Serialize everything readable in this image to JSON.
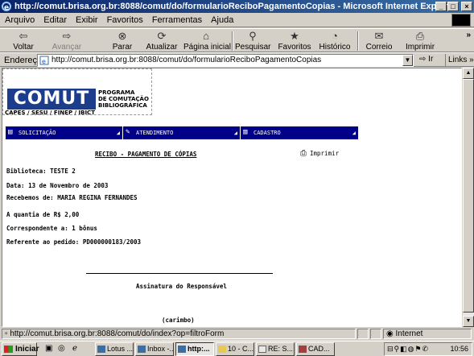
{
  "window": {
    "title": "http://comut.brisa.org.br:8088/comut/do/formularioReciboPagamentoCopias - Microsoft Internet Explorer",
    "controls": {
      "minimize": "_",
      "maximize": "□",
      "close": "×"
    }
  },
  "menubar": {
    "items": [
      "Arquivo",
      "Editar",
      "Exibir",
      "Favoritos",
      "Ferramentas",
      "Ajuda"
    ]
  },
  "toolbar": {
    "buttons": [
      {
        "label": "Voltar",
        "icon": "back-arrow-icon",
        "glyph": "⇦"
      },
      {
        "label": "Avançar",
        "icon": "forward-arrow-icon",
        "glyph": "⇨"
      },
      {
        "label": "Parar",
        "icon": "stop-icon",
        "glyph": "⊗"
      },
      {
        "label": "Atualizar",
        "icon": "refresh-icon",
        "glyph": "⟳"
      },
      {
        "label": "Página inicial",
        "icon": "home-icon",
        "glyph": "⌂"
      },
      {
        "label": "Pesquisar",
        "icon": "search-icon",
        "glyph": "⚲"
      },
      {
        "label": "Favoritos",
        "icon": "favorites-icon",
        "glyph": "★"
      },
      {
        "label": "Histórico",
        "icon": "history-icon",
        "glyph": "◔"
      },
      {
        "label": "Correio",
        "icon": "mail-icon",
        "glyph": "✉"
      },
      {
        "label": "Imprimir",
        "icon": "print-icon",
        "glyph": "⎙"
      }
    ],
    "overflow": "»"
  },
  "addressbar": {
    "label": "Endereço",
    "url": "http://comut.brisa.org.br:8088/comut/do/formularioReciboPagamentoCopias",
    "go_label": "Ir",
    "links_label": "Links »"
  },
  "page": {
    "logo": {
      "brand": "COMUT",
      "program_lines": [
        "PROGRAMA",
        "DE COMUTAÇÃO",
        "BIBLIOGRÁFICA"
      ],
      "sponsors": "CAPES / SESU / FINEP / IBICT"
    },
    "nav": [
      {
        "label": "SOLICITAÇÃO",
        "icon": "form-icon",
        "glyph": "▤"
      },
      {
        "label": "ATENDIMENTO",
        "icon": "service-icon",
        "glyph": "✎"
      },
      {
        "label": "CADASTRO",
        "icon": "register-icon",
        "glyph": "▥"
      }
    ],
    "receipt": {
      "title": "RECIBO - PAGAMENTO DE CÓPIAS",
      "print_label": "Imprimir",
      "biblioteca": "Biblioteca: TESTE 2",
      "data": "Data: 13 de Novembro de 2003",
      "recebemos": "Recebemos de: MARIA REGINA FERNANDES",
      "quantia": "A quantia de R$ 2,00",
      "correspondente": "Correspondente a: 1 bônus",
      "referente": "Referente ao pedido: PD000000183/2003",
      "assinatura": "Assinatura do Responsável",
      "carimbo": "(carimbo)"
    }
  },
  "statusbar": {
    "url": "http://comut.brisa.org.br:8088/comut/do/index?op=filtroForm",
    "zone": "Internet"
  },
  "taskbar": {
    "start_label": "Iniciar",
    "quick_launch": [
      "desktop-icon",
      "outlook-icon",
      "ie-icon"
    ],
    "tasks": [
      {
        "label": "Lotus ...",
        "active": false
      },
      {
        "label": "Inbox -...",
        "active": false
      },
      {
        "label": "http:...",
        "active": true
      },
      {
        "label": "10 - C...",
        "active": false
      },
      {
        "label": "RE: S...",
        "active": false
      },
      {
        "label": "CAD...",
        "active": false
      }
    ],
    "clock": "10:56"
  },
  "colors": {
    "titlebar_start": "#0a246a",
    "titlebar_end": "#3a6ea5",
    "nav_background": "#000088",
    "logo_blue": "#1c3c8c",
    "chrome": "#d4d0c8"
  }
}
